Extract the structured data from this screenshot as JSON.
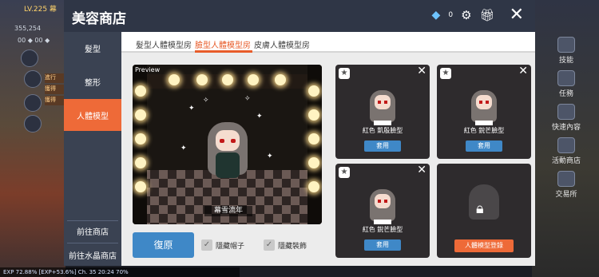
{
  "game": {
    "level": "LV.225 幕",
    "hud_top": "355,254",
    "hud_row": "00 ◆ 00 ◆",
    "quests": [
      "進行",
      "獲得",
      "獲得"
    ],
    "status": "EXP 72.88%  [EXP+53.6%]  Ch. 35 20:24  70%",
    "right_menu": [
      "技能",
      "任務",
      "快速內容",
      "活動商店",
      "交易所"
    ]
  },
  "modal": {
    "title": "美容商店",
    "gem_count": "0",
    "sidebar": {
      "items": [
        "髮型",
        "整形",
        "人體模型"
      ],
      "active_index": 2,
      "links": [
        "前往商店",
        "前往水晶商店"
      ]
    },
    "tabs": [
      "髮型人體模型房",
      "臉型人體模型房",
      "皮膚人體模型房"
    ],
    "active_tab": 1,
    "preview": {
      "label": "Preview",
      "character_name": "幕雪流年"
    },
    "cards": [
      {
        "label": "紅色 凱殷臉型",
        "button": "套用"
      },
      {
        "label": "紅色 銳芒臉型",
        "button": "套用"
      },
      {
        "label": "紅色 銳芒臉型",
        "button": "套用"
      }
    ],
    "locked_card": {
      "button": "人體模型登錄"
    },
    "restore_button": "復原",
    "checkboxes": [
      "隱藏帽子",
      "隱藏裝飾"
    ]
  },
  "colors": {
    "accent": "#ee6a38",
    "button_blue": "#3f88c7",
    "header": "#2f3646"
  }
}
